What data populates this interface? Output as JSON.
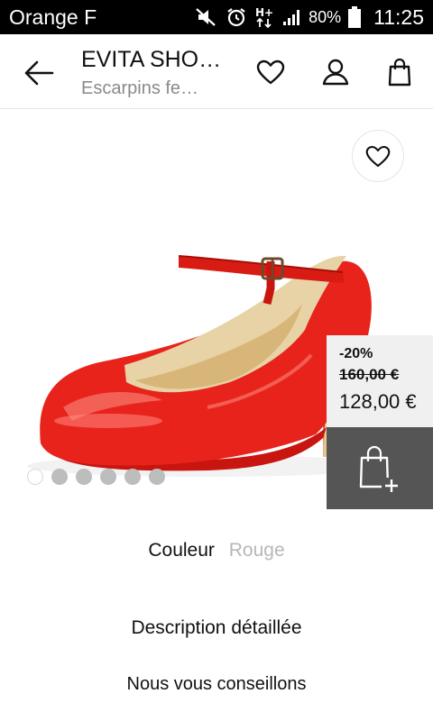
{
  "status_bar": {
    "carrier": "Orange F",
    "battery_percent": "80%",
    "time": "11:25",
    "icons": [
      "mute-icon",
      "alarm-icon",
      "hplus-data-icon",
      "signal-icon",
      "battery-icon"
    ]
  },
  "header": {
    "title": "EVITA SHO…",
    "subtitle": "Escarpins fe…",
    "icons": [
      "back-arrow-icon",
      "heart-icon",
      "user-icon",
      "shopping-bag-icon"
    ]
  },
  "product": {
    "image": "red-patent-mary-jane-pump",
    "image_colors": {
      "shoe": "#e8231c",
      "lining": "#e8d3a6"
    },
    "carousel": {
      "count": 6,
      "active_index": 0
    },
    "price": {
      "discount": "-20%",
      "old": "160,00 €",
      "new": "128,00 €"
    }
  },
  "details": {
    "color_label": "Couleur",
    "color_value": "Rouge",
    "description_label": "Description détaillée",
    "advice_label": "Nous vous conseillons"
  }
}
